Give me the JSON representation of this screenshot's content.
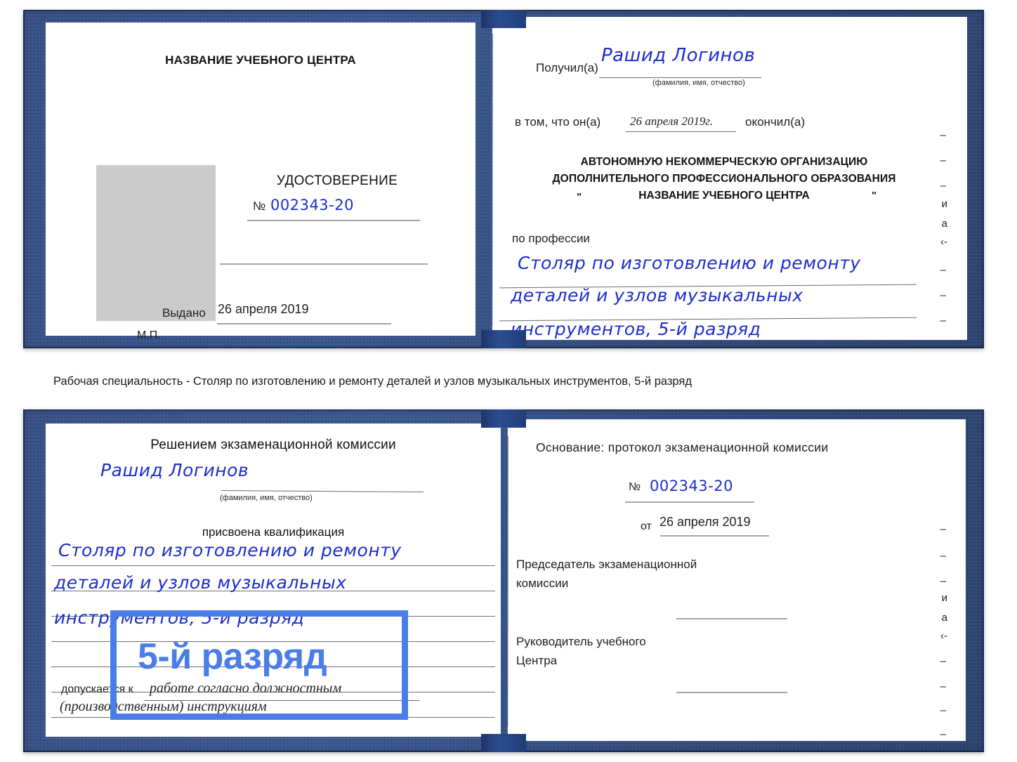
{
  "document": {
    "type": "certificate-scan",
    "caption": "Рабочая специальность - Столяр по изготовлению и ремонту деталей и узлов музыкальных инструментов, 5-й разряд"
  },
  "certificate_front": {
    "left_page": {
      "org_title": "НАЗВАНИЕ УЧЕБНОГО ЦЕНТРА",
      "doc_type": "УДОСТОВЕРЕНИЕ",
      "number_symbol": "№",
      "number_value": "002343-20",
      "issued_label": "Выдано",
      "issued_value": "26 апреля 2019",
      "stamp_label": "М.П."
    },
    "right_page": {
      "received_label": "Получил(а)",
      "received_value": "Рашид Логинов",
      "name_hint": "(фамилия, имя, отчество)",
      "in_that_label": "в том, что он(а)",
      "completion_date": "26 апреля 2019г.",
      "finished_label": "окончил(а)",
      "org_line1": "АВТОНОМНУЮ НЕКОММЕРЧЕСКУЮ ОРГАНИЗАЦИЮ",
      "org_line2": "ДОПОЛНИТЕЛЬНОГО ПРОФЕССИОНАЛЬНОГО ОБРАЗОВАНИЯ",
      "org_quote_open": "\"",
      "org_line3": "НАЗВАНИЕ УЧЕБНОГО ЦЕНТРА",
      "org_quote_close": "\"",
      "profession_label": "по профессии",
      "profession_line1": "Столяр по изготовлению и ремонту",
      "profession_line2": "деталей и узлов музыкальных",
      "profession_line3": "инструментов, 5-й разряд",
      "edge_fragments": [
        "–",
        "–",
        "–",
        "и",
        "а",
        "‹-",
        "–",
        "–",
        "–"
      ]
    }
  },
  "certificate_back": {
    "left_page": {
      "heading": "Решением экзаменационной комиссии",
      "name_value": "Рашид Логинов",
      "name_hint": "(фамилия, имя, отчество)",
      "qualification_label": "присвоена квалификация",
      "qualification_line1": "Столяр по изготовлению и ремонту",
      "qualification_line2": "деталей и узлов музыкальных",
      "qualification_line3": "инструментов, 5-й разряд",
      "admitted_label": "допускается к",
      "admitted_value_line1": "работе согласно должностным",
      "admitted_value_line2": "(производственным) инструкциям"
    },
    "right_page": {
      "basis_label": "Основание: протокол экзаменационной комиссии",
      "number_symbol": "№",
      "number_value": "002343-20",
      "date_prefix": "от",
      "date_value": "26 апреля 2019",
      "chairman_line1": "Председатель экзаменационной",
      "chairman_line2": "комиссии",
      "head_line1": "Руководитель учебного",
      "head_line2": "Центра",
      "edge_fragments": [
        "–",
        "–",
        "–",
        "и",
        "а",
        "‹-",
        "–",
        "–",
        "–",
        "–"
      ]
    }
  },
  "annotation": {
    "highlight_label": "5-й разряд",
    "highlight_color": "#4b7de8"
  },
  "colors": {
    "cover_blue": "#2a4a8c",
    "ink_blue": "#1c2ecb",
    "accent_blue": "#4b7de8",
    "photo_placeholder": "#cbcbcb",
    "paper": "#ffffff"
  }
}
